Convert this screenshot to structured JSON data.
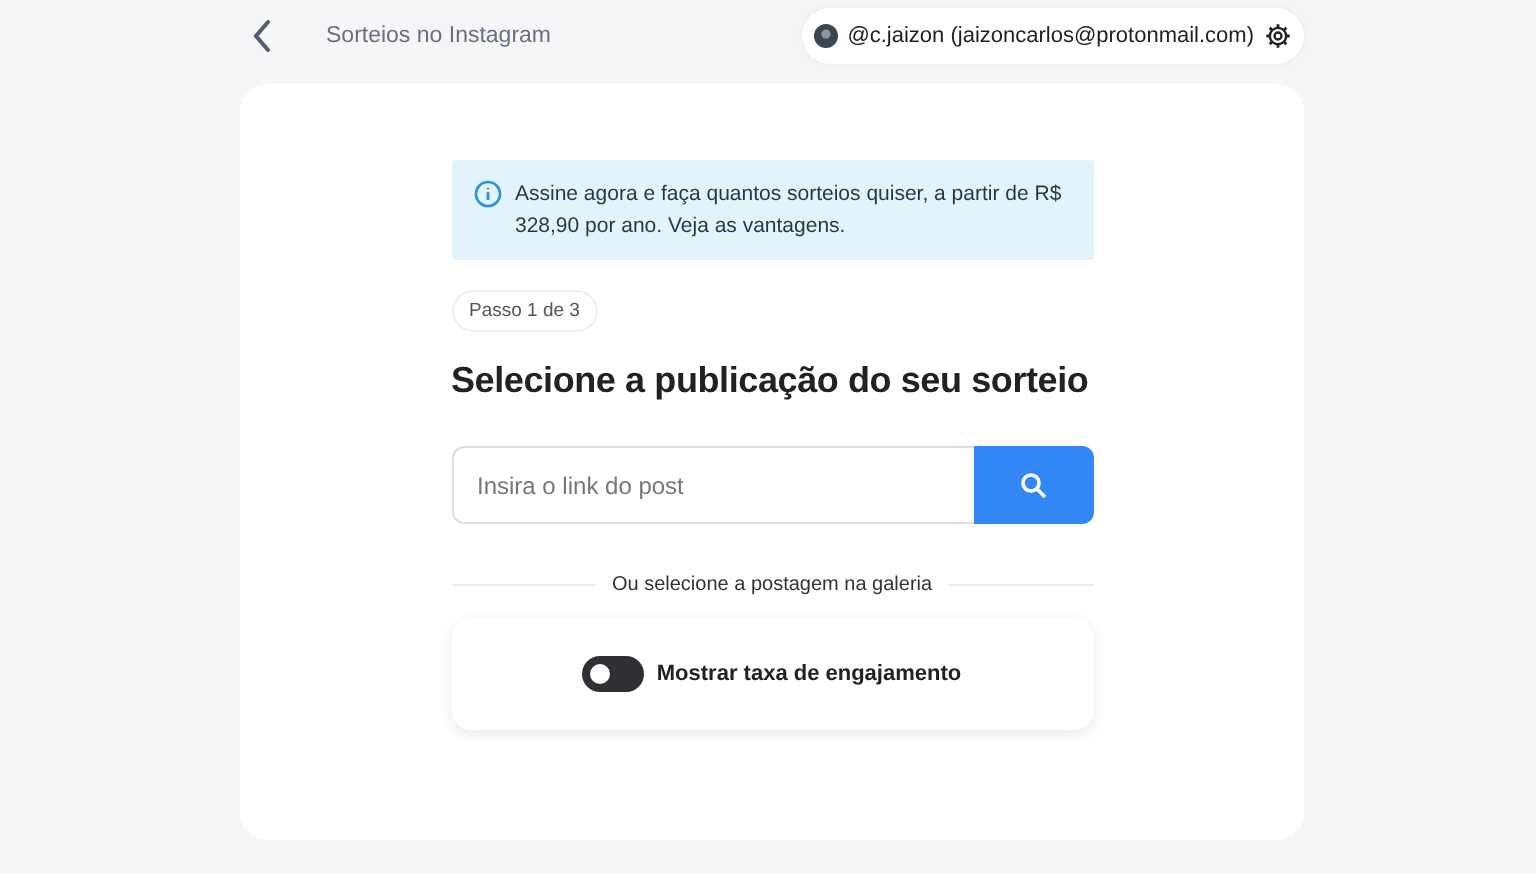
{
  "header": {
    "title": "Sorteios no Instagram",
    "account": "@c.jaizon (jaizoncarlos@protonmail.com)"
  },
  "notice": "Assine agora e faça quantos sorteios quiser, a partir de R$ 328,90 por ano. Veja as vantagens.",
  "step": "Passo 1 de 3",
  "heading": "Selecione a publicação do seu sorteio",
  "search": {
    "placeholder": "Insira o link do post"
  },
  "divider_text": "Ou selecione a postagem na galeria",
  "engagement_toggle": {
    "label": "Mostrar taxa de engajamento",
    "on": false
  }
}
